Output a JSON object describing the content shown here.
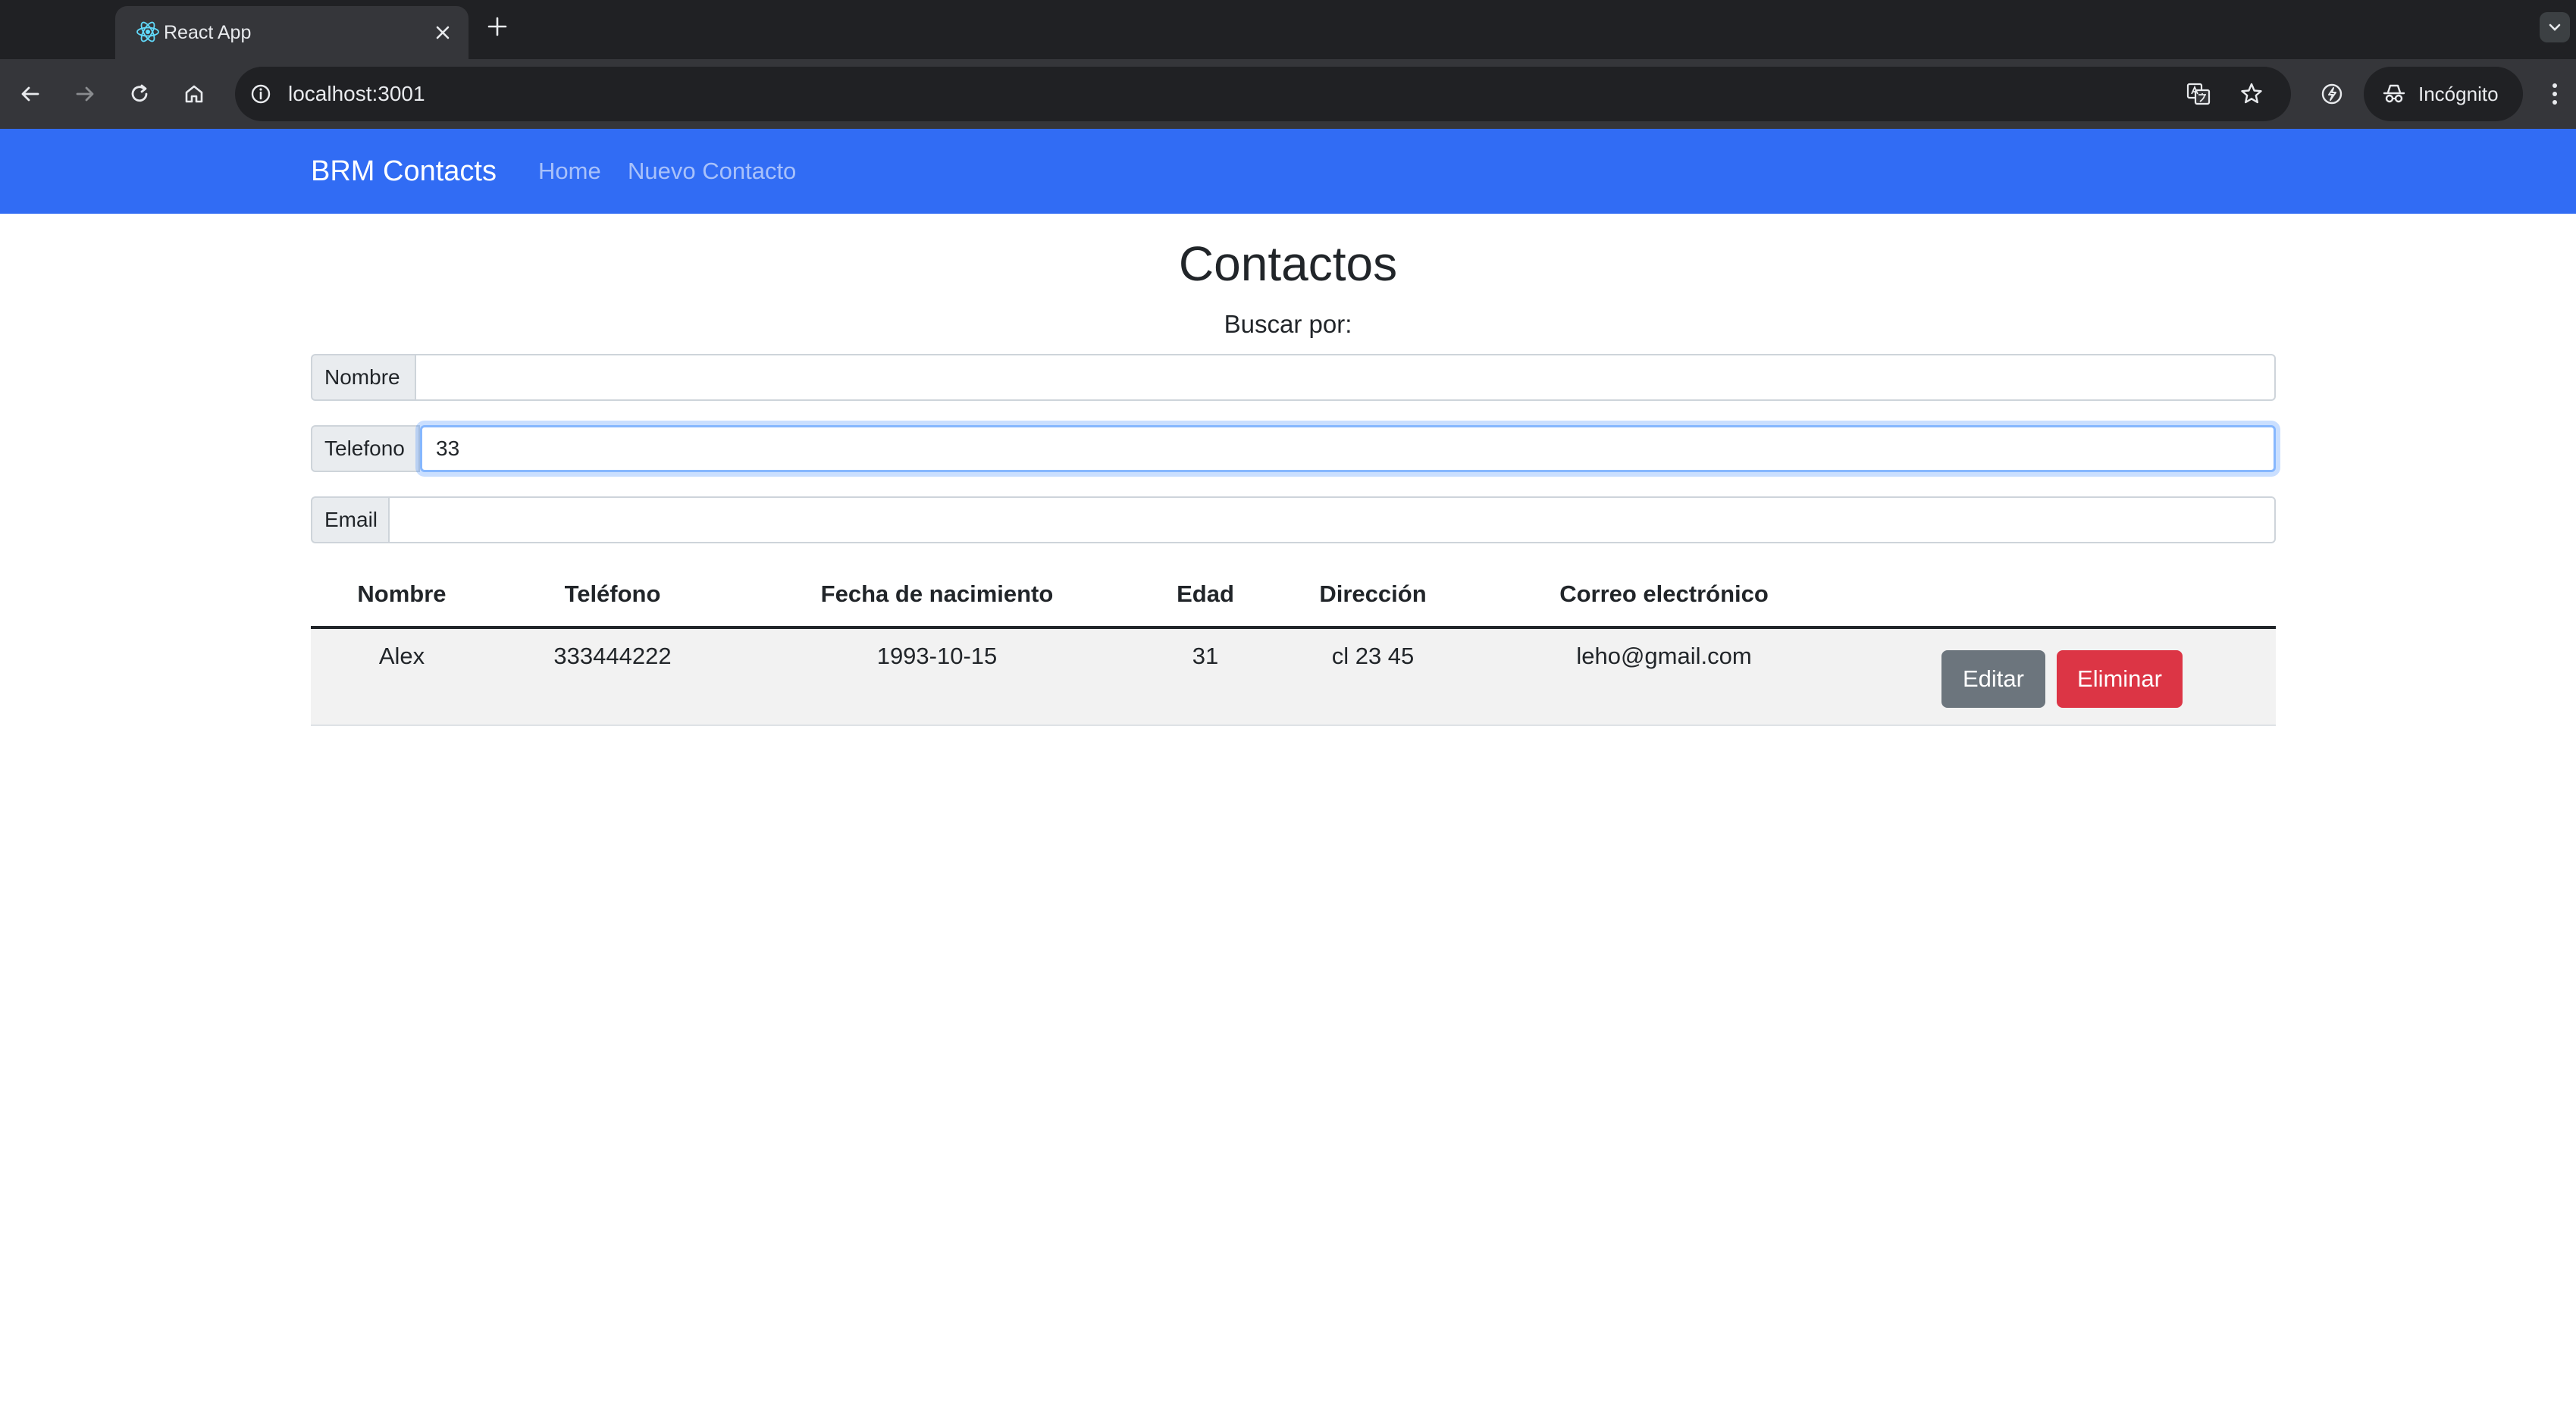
{
  "browser": {
    "tab_title": "React App",
    "url": "localhost:3001",
    "profile_label": "Incógnito"
  },
  "navbar": {
    "brand": "BRM Contacts",
    "links": [
      "Home",
      "Nuevo Contacto"
    ],
    "color": "#316cf4"
  },
  "page": {
    "title": "Contactos",
    "search_caption": "Buscar por:"
  },
  "filters": {
    "nombre": {
      "label": "Nombre",
      "value": ""
    },
    "telefono": {
      "label": "Telefono",
      "value": "33"
    },
    "email": {
      "label": "Email",
      "value": ""
    }
  },
  "table": {
    "headers": [
      "Nombre",
      "Teléfono",
      "Fecha de nacimiento",
      "Edad",
      "Dirección",
      "Correo electrónico"
    ],
    "rows": [
      {
        "nombre": "Alex",
        "telefono": "333444222",
        "fecha": "1993-10-15",
        "edad": "31",
        "direccion": "cl 23 45",
        "correo": "leho@gmail.com",
        "edit_label": "Editar",
        "delete_label": "Eliminar"
      }
    ]
  },
  "colors": {
    "edit_button": "#6c757d",
    "delete_button": "#dc3545"
  }
}
